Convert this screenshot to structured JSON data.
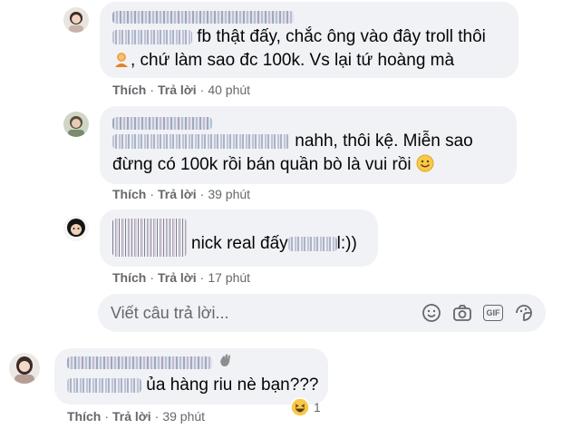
{
  "comments": [
    {
      "line1_text": "fb thật đấy, chắc ông vào đây troll thôi",
      "line2_text": ", chứ làm sao đc 100k. Vs lại tứ hoàng mà",
      "like_label": "Thích",
      "reply_label": "Trả lời",
      "time": "40 phút"
    },
    {
      "line1_text": "nahh, thôi kệ. Miễn sao",
      "line2_text": "đừng có 100k rồi bán quần bò là vui rồi",
      "like_label": "Thích",
      "reply_label": "Trả lời",
      "time": "39 phút"
    },
    {
      "line1_text": "nick real đấy",
      "line1_suffix": "l:))",
      "like_label": "Thích",
      "reply_label": "Trả lời",
      "time": "17 phút"
    },
    {
      "line1_text": "ủa hàng riu nè bạn???",
      "like_label": "Thích",
      "reply_label": "Trả lời",
      "time": "39 phút",
      "reaction_count": "1"
    }
  ],
  "separator": "·",
  "reply_box": {
    "placeholder": "Viết câu trả lời...",
    "icons": [
      "smiley-icon",
      "camera-icon",
      "gif-icon",
      "sticker-icon"
    ],
    "gif_label": "GIF"
  },
  "colors": {
    "bubble": "#f0f2f5",
    "meta_text": "#65676b",
    "text": "#050505"
  }
}
